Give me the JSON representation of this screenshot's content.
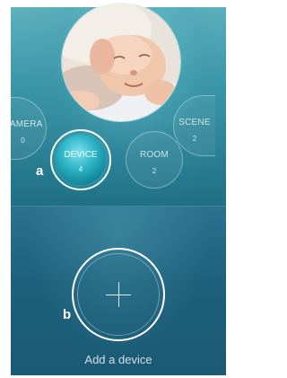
{
  "nav": {
    "camera": {
      "label": "CAMERA",
      "count": "0"
    },
    "device": {
      "label": "DEVICE",
      "count": "4"
    },
    "room": {
      "label": "ROOM",
      "count": "2"
    },
    "scene": {
      "label": "SCENE",
      "count": "2"
    }
  },
  "callouts": {
    "a": "a",
    "b": "b"
  },
  "add": {
    "label": "Add a device",
    "icon": "plus-icon"
  },
  "photo": {
    "subject": "sleeping baby"
  },
  "colors": {
    "panel_top": "#3a95a7",
    "panel_bottom": "#1d607d",
    "selected_device": "#2cb4c6",
    "highlight_ring": "#ffffff"
  }
}
